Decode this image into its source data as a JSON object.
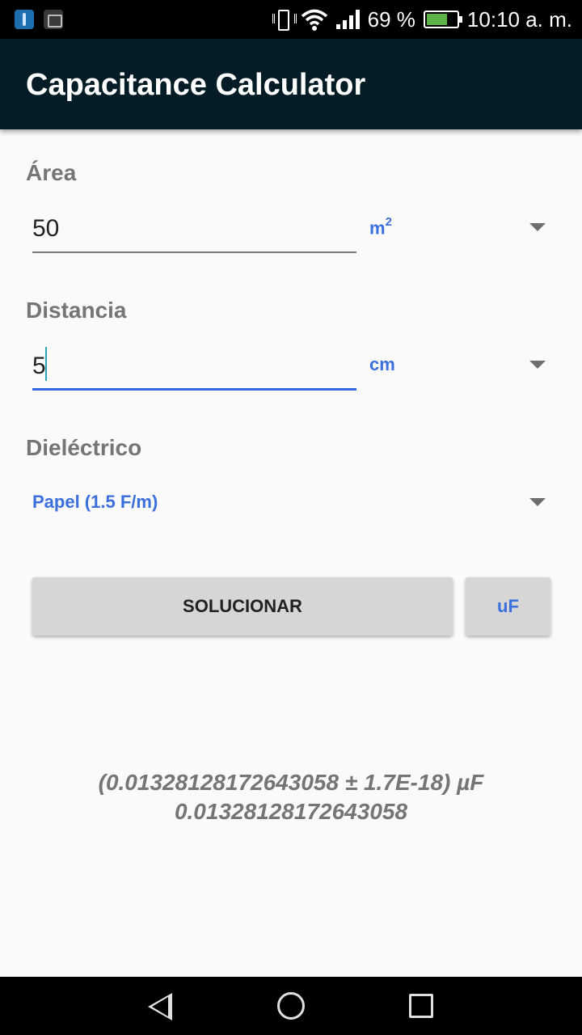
{
  "status_bar": {
    "battery_percent_text": "69 %",
    "battery_level": 0.69,
    "time": "10:10 a. m.",
    "icons": [
      "usb-icon",
      "image-notification-icon",
      "vibrate-icon",
      "wifi-icon",
      "signal-icon",
      "battery-charging-icon"
    ]
  },
  "app_bar": {
    "title": "Capacitance Calculator"
  },
  "area": {
    "label": "Área",
    "value": "50",
    "unit": "m",
    "unit_sup": "2"
  },
  "distance": {
    "label": "Distancia",
    "value": "5",
    "unit": "cm"
  },
  "dielectric": {
    "label": "Dieléctrico",
    "value": "Papel (1.5 F/m)"
  },
  "buttons": {
    "solve": "SOLUCIONAR",
    "unit": "uF"
  },
  "result": {
    "line1": "(0.013281281726430​58 ± 1.7E-18) µF",
    "line2": "0.01328128172643058"
  },
  "colors": {
    "app_bar": "#041c26",
    "accent": "#3367e0",
    "spinner_text": "#3a6fdc",
    "label": "#757575"
  },
  "nav_bar": {
    "icons": [
      "back-icon",
      "home-icon",
      "recents-icon"
    ]
  }
}
